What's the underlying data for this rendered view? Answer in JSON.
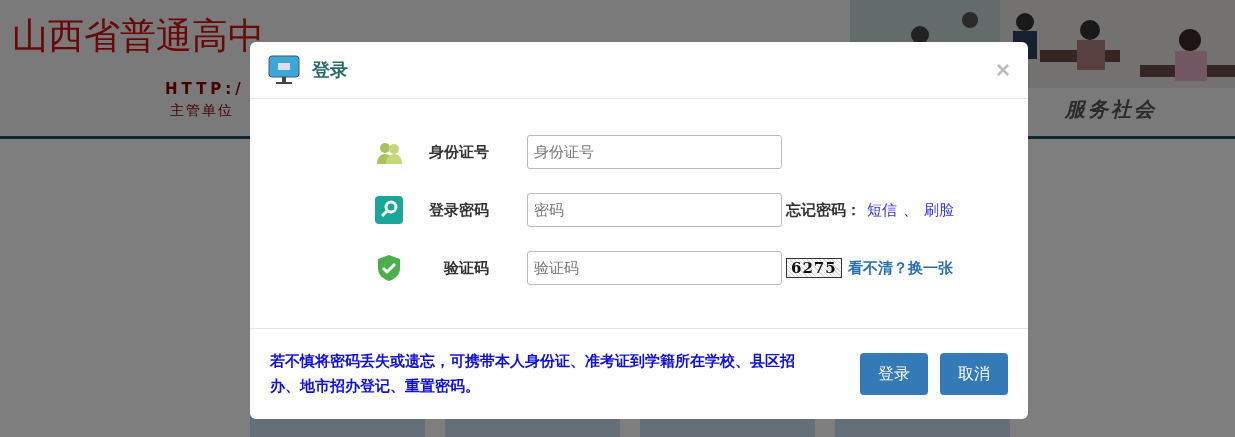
{
  "page": {
    "title": "山西省普通高中",
    "url": "HTTP:/",
    "authority": "主管单位",
    "slogan": "服务社会"
  },
  "dialog": {
    "title": "登录",
    "close": "×",
    "fields": [
      {
        "kind": "id",
        "label": "身份证号",
        "placeholder": "身份证号"
      },
      {
        "kind": "password",
        "label": "登录密码",
        "placeholder": "密码",
        "forgot_label": "忘记密码：",
        "links": [
          "短信",
          "刷脸"
        ],
        "separator": "、"
      },
      {
        "kind": "captcha",
        "label": "验证码",
        "placeholder": "验证码",
        "captcha": "6275",
        "refresh": "看不清？换一张"
      }
    ],
    "note": "若不慎将密码丢失或遗忘，可携带本人身份证、准考证到学籍所在学校、县区招办、地市招办登记、重置密码。",
    "buttons": [
      "登录",
      "取消"
    ]
  }
}
